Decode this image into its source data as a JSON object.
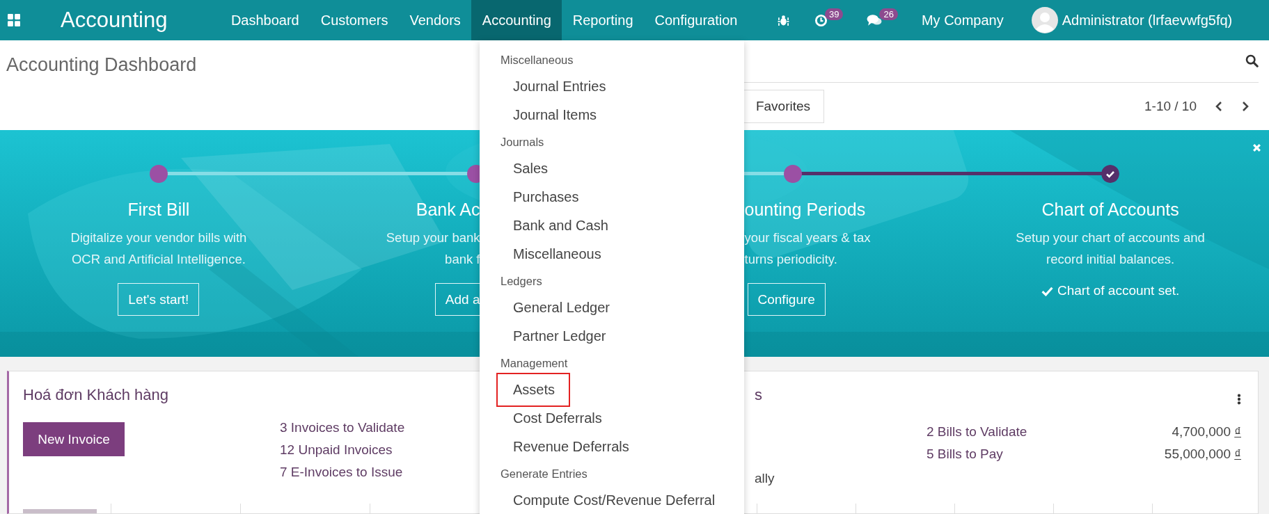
{
  "navbar": {
    "brand": "Accounting",
    "menus": [
      {
        "label": "Dashboard",
        "selected": false
      },
      {
        "label": "Customers",
        "selected": false
      },
      {
        "label": "Vendors",
        "selected": false
      },
      {
        "label": "Accounting",
        "selected": true
      },
      {
        "label": "Reporting",
        "selected": false
      },
      {
        "label": "Configuration",
        "selected": false
      }
    ],
    "activity_count": "39",
    "message_count": "26",
    "company": "My Company",
    "user": "Administrator (lrfaevwfg5fq)"
  },
  "control_panel": {
    "title": "Accounting Dashboard",
    "favorites": "Favorites",
    "pager": "1-10 / 10"
  },
  "onboarding": {
    "steps": [
      {
        "kind": "full",
        "done": false,
        "title": "First Bill",
        "lines": [
          "Digitalize your vendor bills with",
          "OCR and Artificial Intelligence."
        ],
        "action": {
          "kind": "button",
          "label": "Let's start!"
        }
      },
      {
        "kind": "cut_end",
        "done": false,
        "title": "Bank Ac",
        "lines": [
          "Setup your bank",
          "bank f"
        ],
        "action": {
          "kind": "button",
          "label": "Add a"
        }
      },
      {
        "kind": "cut_start",
        "done": false,
        "title": "ounting Periods",
        "lines": [
          "your fiscal years & tax",
          "turns periodicity."
        ],
        "action": {
          "kind": "button",
          "label": "Configure"
        }
      },
      {
        "kind": "full",
        "done": true,
        "title": "Chart of Accounts",
        "lines": [
          "Setup your chart of accounts and",
          "record initial balances."
        ],
        "action": {
          "kind": "note",
          "label": "Chart of account set."
        }
      }
    ]
  },
  "journals": [
    {
      "kind": "sale",
      "title": "Hoá đơn Khách hàng",
      "button": "New Invoice",
      "links": [
        "3 Invoices to Validate",
        "12 Unpaid Invoices",
        "7 E-Invoices to Issue"
      ]
    },
    {
      "kind": "purchase",
      "title": "s",
      "note": "ally",
      "rows": [
        {
          "label": "2 Bills to Validate",
          "amount": "4,700,000",
          "currency": "₫"
        },
        {
          "label": "5 Bills to Pay",
          "amount": "55,000,000",
          "currency": "₫"
        }
      ]
    }
  ],
  "menu": {
    "sections": [
      {
        "header": "Miscellaneous",
        "items": [
          {
            "label": "Journal Entries",
            "selected": false
          },
          {
            "label": "Journal Items",
            "selected": false
          }
        ]
      },
      {
        "header": "Journals",
        "items": [
          {
            "label": "Sales",
            "selected": false
          },
          {
            "label": "Purchases",
            "selected": false
          },
          {
            "label": "Bank and Cash",
            "selected": false
          },
          {
            "label": "Miscellaneous",
            "selected": false
          }
        ]
      },
      {
        "header": "Ledgers",
        "items": [
          {
            "label": "General Ledger",
            "selected": false
          },
          {
            "label": "Partner Ledger",
            "selected": false
          }
        ]
      },
      {
        "header": "Management",
        "items": [
          {
            "label": "Assets",
            "selected": true
          },
          {
            "label": "Cost Deferrals",
            "selected": false
          },
          {
            "label": "Revenue Deferrals",
            "selected": false
          }
        ]
      },
      {
        "header": "Generate Entries",
        "items": [
          {
            "label": "Compute Cost/Revenue Deferral",
            "selected": false
          }
        ]
      }
    ]
  }
}
